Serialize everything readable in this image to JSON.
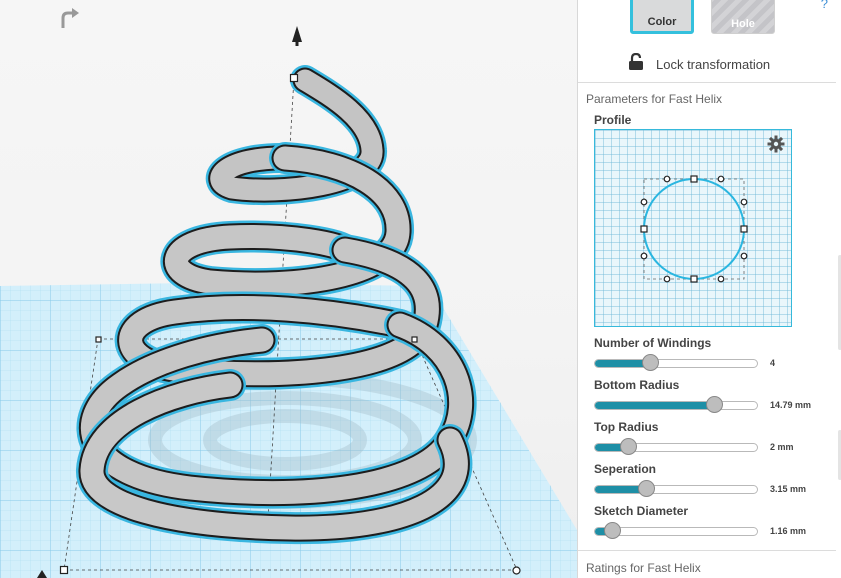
{
  "viewport": {
    "rotate_icon": "rotate-view-icon",
    "up_arrow": "workplane-up-arrow-icon",
    "shape": "fast-helix-spring",
    "colors": {
      "shape": "#c8c8c8",
      "selection": "#39b6e0",
      "grid": "#8fd0ec",
      "grid_fill": "#cfeefb"
    }
  },
  "panel": {
    "help_label": "?",
    "buttons": {
      "color_label": "Color",
      "hole_label": "Hole"
    },
    "lock_label": "Lock transformation",
    "parameters_title": "Parameters for Fast Helix",
    "profile_label": "Profile",
    "profile_gear": "gear-icon",
    "params": [
      {
        "label": "Number of Windings",
        "value": "4",
        "level": 0.34
      },
      {
        "label": "Bottom Radius",
        "value": "14.79 mm",
        "level": 0.73
      },
      {
        "label": "Top Radius",
        "value": "2 mm",
        "level": 0.21
      },
      {
        "label": "Seperation",
        "value": "3.15 mm",
        "level": 0.32
      },
      {
        "label": "Sketch Diameter",
        "value": "1.16 mm",
        "level": 0.11
      }
    ],
    "ratings_title": "Ratings for Fast Helix",
    "colors": {
      "accent": "#34c0dd",
      "slider_fill": "#1e8fa6"
    }
  }
}
